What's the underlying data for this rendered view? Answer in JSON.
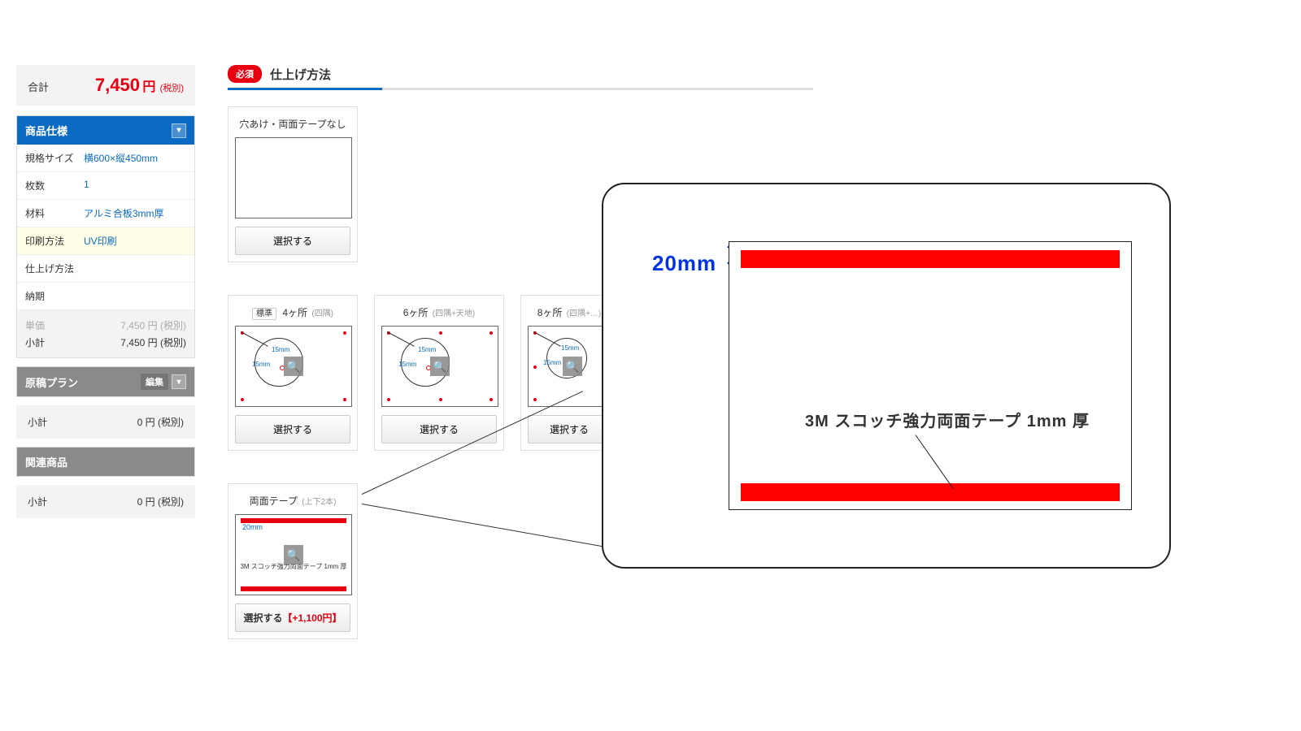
{
  "sidebar": {
    "total": {
      "label": "合計",
      "price": "7,450",
      "currency": "円",
      "tax": "(税別)"
    },
    "spec": {
      "heading": "商品仕様",
      "rows": [
        {
          "label": "規格サイズ",
          "value": "横600×縦450mm"
        },
        {
          "label": "枚数",
          "value": "1"
        },
        {
          "label": "材料",
          "value": "アルミ合板3mm厚"
        },
        {
          "label": "印刷方法",
          "value": "UV印刷"
        },
        {
          "label": "仕上げ方法",
          "value": ""
        },
        {
          "label": "納期",
          "value": ""
        }
      ],
      "unit": {
        "label": "単価",
        "value": "7,450 円 (税別)"
      },
      "subtotal": {
        "label": "小計",
        "value": "7,450 円 (税別)"
      }
    },
    "plan": {
      "heading": "原稿プラン",
      "edit": "編集",
      "sub_label": "小計",
      "sub_value": "0 円 (税別)"
    },
    "related": {
      "heading": "関連商品",
      "sub_label": "小計",
      "sub_value": "0 円 (税別)"
    }
  },
  "main": {
    "required": "必須",
    "section_title": "仕上げ方法",
    "select": "選択する",
    "select_plus": "選択する【+1,100円】",
    "options": [
      {
        "title": "穴あけ・両面テープなし"
      },
      {
        "badge": "標準",
        "title": "4ヶ所",
        "sub": "(四隅)"
      },
      {
        "title": "6ヶ所",
        "sub": "(四隅+天地)"
      },
      {
        "title": "8ヶ所",
        "sub": "(四隅+…)"
      },
      {
        "title": "両面テープ",
        "sub": "(上下2本)"
      }
    ],
    "measurements": {
      "offset": "15mm",
      "tape_width_small": "20mm",
      "tape_caption_small": "3M スコッチ強力両面テープ 1mm 厚"
    }
  },
  "callout": {
    "width_label": "20mm",
    "caption": "3M スコッチ強力両面テープ 1mm 厚"
  }
}
